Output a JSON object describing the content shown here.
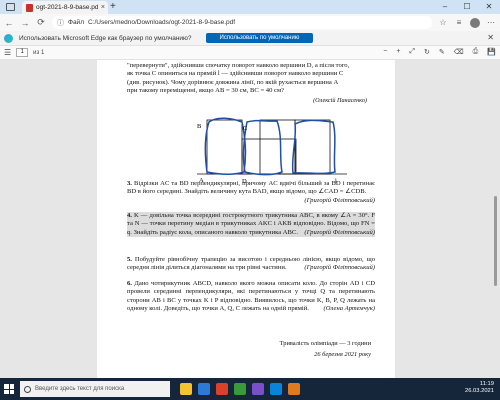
{
  "browser": {
    "tab_title": "ogt-2021-8-9-base.pdf",
    "tab_close": "×",
    "new_tab": "+",
    "window_controls": [
      "–",
      "☐",
      "✕"
    ],
    "nav_back": "←",
    "nav_forward": "→",
    "nav_refresh": "⟳",
    "url_info": "ⓘ",
    "url_label": "Файл",
    "url_path": "C:/Users/medno/Downloads/ogt-2021-8-9-base.pdf",
    "notification": "Использовать Microsoft Edge как браузер по умолчанию?",
    "notification_button": "Использовать по умолчанию",
    "notification_close": "✕",
    "page_number": "1",
    "page_of": "из 1"
  },
  "document": {
    "intro_lines": [
      "\"перевернути\", здійснивши спочатку поворот навколо вершини D, а після того,",
      "як точка C опиниться на прямій l — здійснивши поворот навколо вершини C",
      "(див. рисунок). Чому дорівнює довжина лінії, по якій рухається вершина A",
      "при такому переміщенні, якщо AB = 30 см, BC = 40 см?"
    ],
    "intro_author": "(Олексій Панасенко)",
    "figure_labels": {
      "B": "B",
      "C": "C",
      "A": "A",
      "D": "D",
      "l": "l"
    },
    "problems": [
      {
        "num": "3.",
        "text": "Відрізки AC та BD перпендикулярні, причому AC вдвічі більший за BD і перетинає BD в його середині. Знайдіть величину кута BAD, якщо відомо, що ∠CAD = ∠CDB.",
        "author": "(Григорій Філіпповський)"
      },
      {
        "num": "4.",
        "text": "K — довільна точка всередині гострокутного трикутника ABC, в якому ∠A = 30°. F та N — точки перетину медіан в трикутниках AKC і AKB відповідно. Відомо, що FN = q. Знайдіть радіус кола, описаного навколо трикутника ABC.",
        "author": "(Григорій Філіпповський)"
      },
      {
        "num": "5.",
        "text": "Побудуйте рівнобічну трапецію за висотою і середньою лінією, якщо відомо, що середня лінія ділиться діагоналями на три рівні частини.",
        "author": "(Григорій Філіпповський)"
      },
      {
        "num": "6.",
        "text": "Дано чотирикутник ABCD, навколо якого можна описати коло. До сторін AD і CD провели серединні перпендикуляри, які перетинаються у точці Q та перетинають сторони AB і BC у точках K і P відповідно. Виявилось, що точки K, B, P, Q лежать на одному колі. Доведіть, що точки A, Q, C лежать на одній прямій.",
        "author": "(Олена Артемчук)"
      }
    ],
    "footer_duration": "Тривалість олімпіади — 3 години",
    "footer_date": "26 березня 2021 року"
  },
  "taskbar": {
    "search_placeholder": "Введите здесь текст для поиска",
    "time": "11:19",
    "date": "26.03.2021",
    "icon_colors": [
      "#f4c430",
      "#2b7bd6",
      "#d9412b",
      "#3a9a3a",
      "#7b4fc9",
      "#0a84d8",
      "#e07a1f"
    ]
  }
}
